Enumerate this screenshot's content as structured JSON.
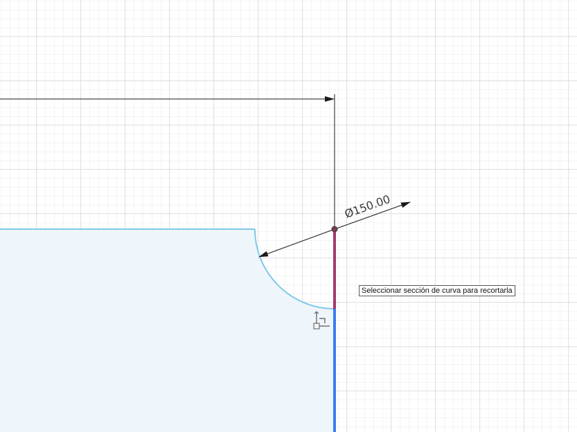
{
  "dimension": {
    "diameter_label": "Ø150.00"
  },
  "tooltip": {
    "text": "Seleccionar sección de curva para recortarla"
  },
  "colors": {
    "grid_minor": "#e6e6e6",
    "grid_major": "#d2d2d2",
    "profile_fill": "#eef6fb",
    "profile_stroke": "#7fc8e8",
    "dimension_line": "#1a1a1a",
    "hover_segment": "#a4396a",
    "selected_line": "#3b7cf5"
  },
  "icons": {
    "cursor": "trim-cursor-icon",
    "point": "sketch-point-icon"
  }
}
